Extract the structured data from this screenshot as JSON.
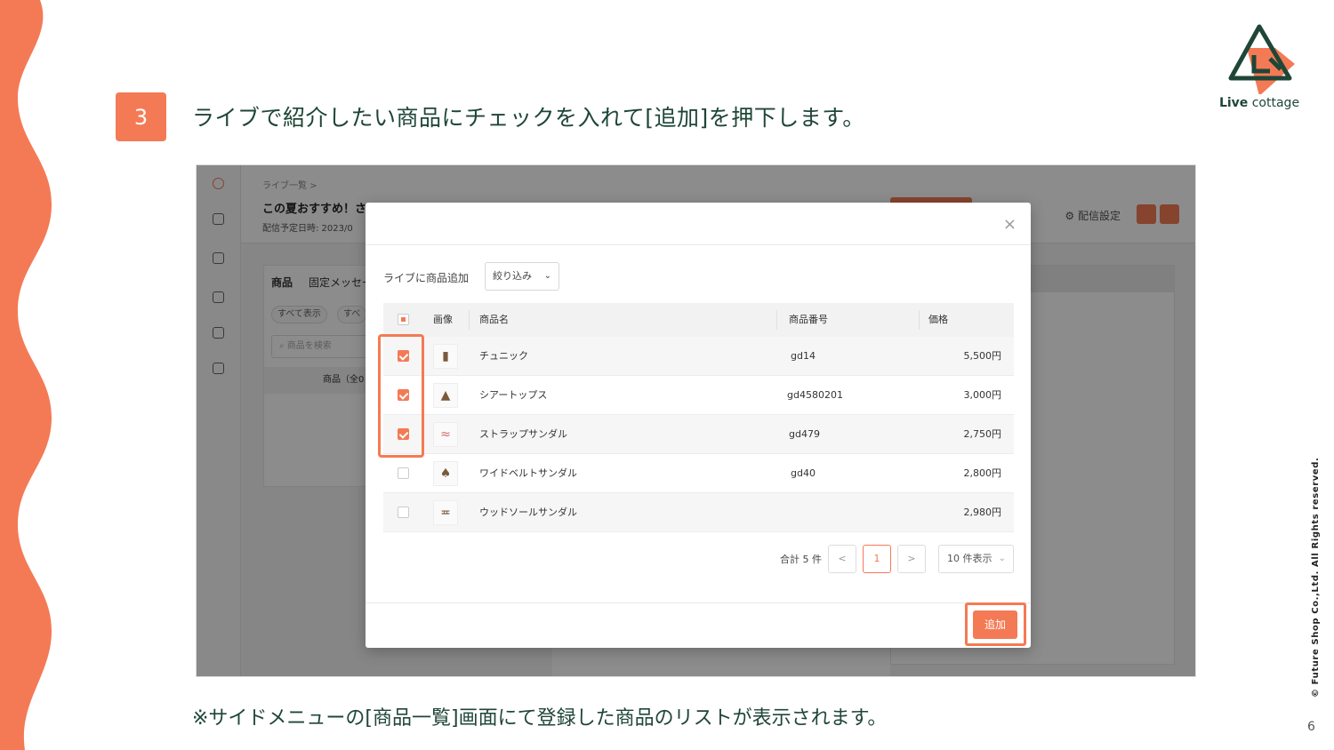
{
  "slide": {
    "step": "3",
    "heading": "ライブで紹介したい商品にチェックを入れて[追加]を押下します。",
    "footnote": "※サイドメニューの[商品一覧]画面にて登録した商品のリストが表示されます。",
    "page_number": "6",
    "copyright": "© Future Shop Co.,Ltd. All Rights reserved.",
    "logo": {
      "bold": "Live",
      "rest": " cottage"
    },
    "accent_color": "#f47a55",
    "text_color": "#1f4637"
  },
  "app": {
    "breadcrumb": "ライブ一覧 >",
    "title": "この夏おすすめ！さ",
    "scheduled": "配信予定日時: 2023/0",
    "settings": "配信設定",
    "tabs": [
      "商品",
      "固定メッセー"
    ],
    "filters": [
      "すべて表示",
      "すべ"
    ],
    "search_placeholder": "商品を検索",
    "list_header": "商品（全0"
  },
  "modal": {
    "label": "ライブに商品追加",
    "filter": "絞り込み",
    "columns": {
      "image": "画像",
      "name": "商品名",
      "code": "商品番号",
      "price": "価格"
    },
    "rows": [
      {
        "name": "チュニック",
        "code": "gd14",
        "price": "5,500円",
        "checked": true,
        "icon": "dress-icon"
      },
      {
        "name": "シアートップス",
        "code": "gd4580201",
        "price": "3,000円",
        "checked": true,
        "icon": "shirt-icon"
      },
      {
        "name": "ストラップサンダル",
        "code": "gd479",
        "price": "2,750円",
        "checked": true,
        "icon": "sandal-icon"
      },
      {
        "name": "ワイドベルトサンダル",
        "code": "gd40",
        "price": "2,800円",
        "checked": false,
        "icon": "sandal-icon"
      },
      {
        "name": "ウッドソールサンダル",
        "code": "",
        "price": "2,980円",
        "checked": false,
        "icon": "sandal-icon"
      }
    ],
    "pager": {
      "total": "合計 5 件",
      "prev": "<",
      "current": "1",
      "next": ">",
      "size": "10 件表示"
    },
    "add_button": "追加",
    "close": "×"
  }
}
